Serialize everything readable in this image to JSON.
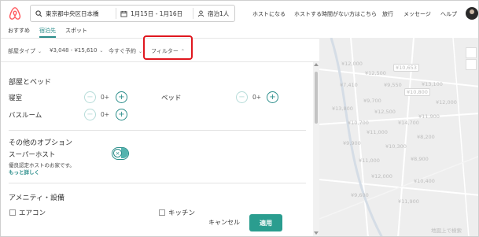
{
  "header": {
    "search": {
      "location": "東京都中央区日本橋",
      "dates": "1月15日 - 1月16日",
      "guests": "宿泊1人"
    },
    "nav": [
      "ホストになる",
      "ホストする時間がない方はこちら",
      "旅行",
      "メッセージ",
      "ヘルプ"
    ]
  },
  "tabs": [
    "おすすめ",
    "宿泊先",
    "スポット"
  ],
  "filters": [
    "部屋タイプ",
    "¥3,048 - ¥15,610",
    "今すぐ予約",
    "フィルター"
  ],
  "panel": {
    "rooms_title": "部屋とベッド",
    "rooms": [
      {
        "label": "寝室",
        "count": "0+"
      },
      {
        "label": "ベッド",
        "count": "0+"
      },
      {
        "label": "バスルーム",
        "count": "0+"
      }
    ],
    "options_title": "その他のオプション",
    "superhost": {
      "label": "スーパーホスト",
      "desc": "優良認定ホストのお家です。",
      "link": "もっと詳しく"
    },
    "amenities_title": "アメニティ・設備",
    "amenities": [
      "エアコン",
      "キッチン"
    ]
  },
  "actions": {
    "cancel": "キャンセル",
    "apply": "適用"
  },
  "map": {
    "prices": [
      "¥12,000",
      "¥10,653",
      "¥12,500",
      "¥7,410",
      "¥9,550",
      "¥13,100",
      "¥10,800",
      "¥9,700",
      "¥12,000",
      "¥13,800",
      "¥12,500",
      "¥11,900",
      "¥10,700",
      "¥14,700",
      "¥11,000",
      "¥8,200",
      "¥9,900",
      "¥10,300",
      "¥11,000",
      "¥8,900",
      "¥12,000",
      "¥10,400",
      "¥9,600",
      "¥11,900"
    ],
    "footer": "地図上で検索"
  },
  "colors": {
    "accent": "#2a8d8a",
    "highlight": "#e0171f",
    "brand": "#ff5a5f",
    "apply_button": "#2a9d8f"
  }
}
